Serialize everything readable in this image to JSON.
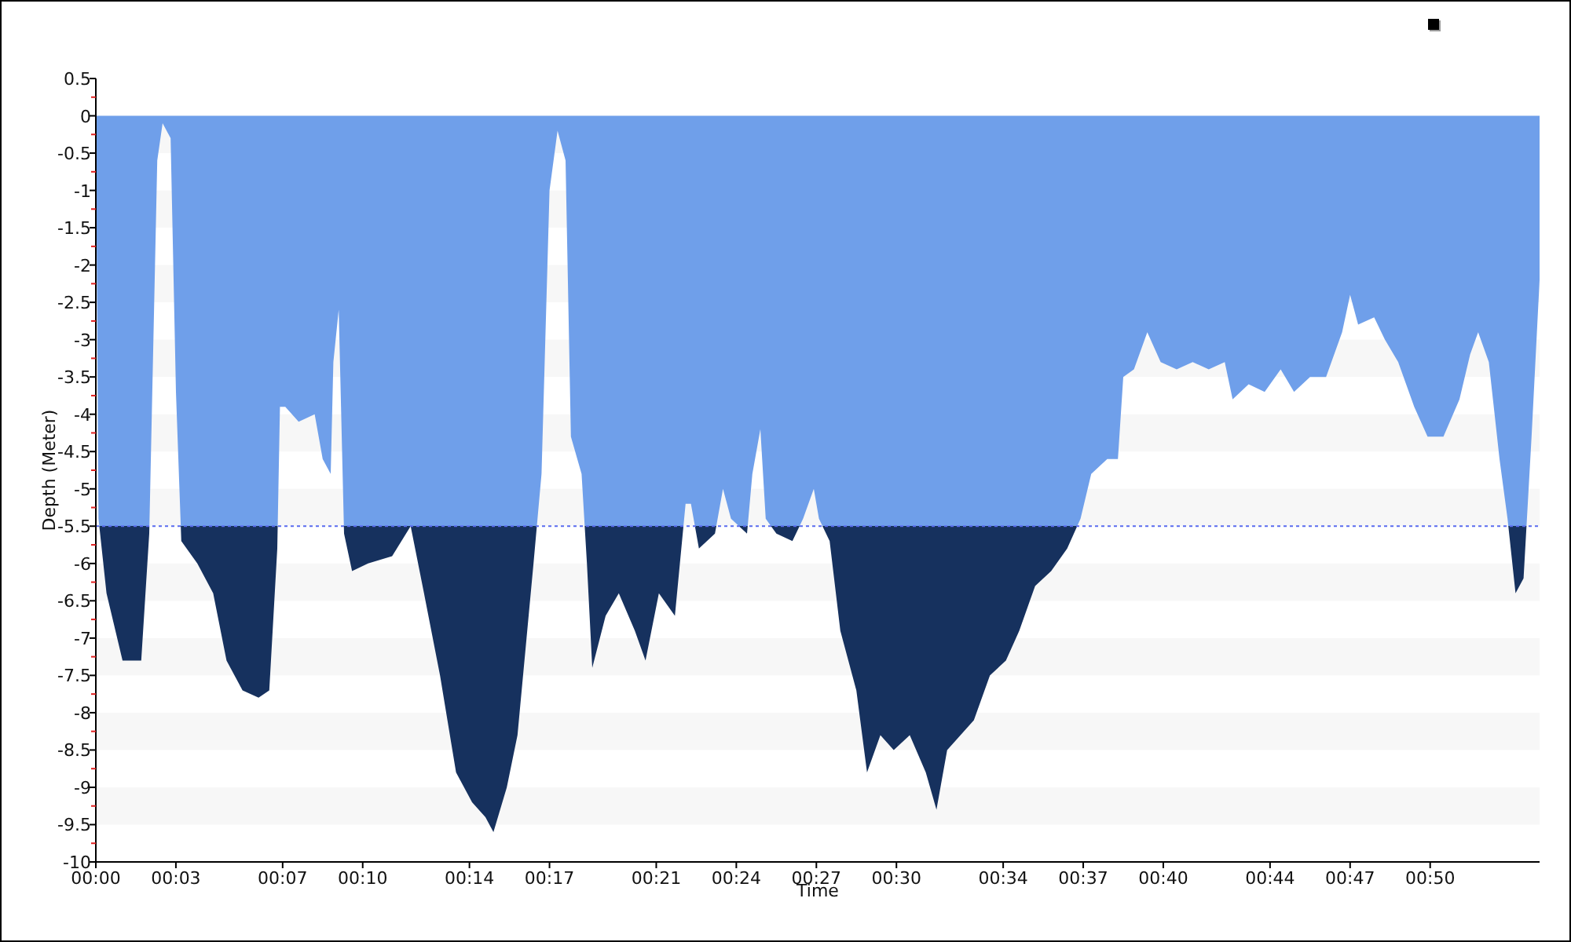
{
  "chart_panel": {
    "chart_data": {
      "type": "area",
      "xlabel": "Time",
      "ylabel": "Depth (Meter)",
      "x": [
        0,
        0.1,
        0.4,
        1.0,
        1.7,
        2.0,
        2.3,
        2.5,
        2.8,
        3.0,
        3.2,
        3.8,
        4.4,
        4.9,
        5.5,
        6.1,
        6.5,
        6.8,
        6.9,
        7.1,
        7.6,
        8.2,
        8.5,
        8.8,
        8.9,
        9.1,
        9.3,
        9.6,
        10.2,
        11.1,
        11.8,
        12.3,
        12.9,
        13.5,
        14.1,
        14.6,
        14.9,
        15.4,
        15.8,
        16.4,
        16.7,
        17.0,
        17.3,
        17.6,
        17.8,
        18.2,
        18.4,
        18.6,
        19.1,
        19.6,
        20.2,
        20.6,
        21.1,
        21.7,
        22.1,
        22.3,
        22.6,
        23.2,
        23.5,
        23.8,
        24.4,
        24.6,
        24.9,
        25.1,
        25.5,
        26.1,
        26.5,
        26.9,
        27.1,
        27.5,
        27.9,
        28.5,
        28.9,
        29.4,
        29.9,
        30.5,
        31.1,
        31.5,
        31.9,
        32.4,
        32.9,
        33.5,
        34.1,
        34.6,
        35.2,
        35.8,
        36.4,
        36.9,
        37.3,
        37.9,
        38.3,
        38.5,
        38.9,
        39.4,
        39.9,
        40.5,
        41.1,
        41.7,
        42.3,
        42.6,
        43.2,
        43.8,
        44.4,
        44.9,
        45.5,
        46.1,
        46.7,
        47.0,
        47.3,
        47.9,
        48.3,
        48.8,
        49.4,
        49.9,
        50.5,
        51.1,
        51.5,
        51.8,
        52.2,
        52.6,
        52.9,
        53.2,
        53.5,
        53.8,
        54.1
      ],
      "series": [
        {
          "color": "#6f9fea",
          "values": [
            0,
            -5.4,
            -6.4,
            -7.3,
            -7.3,
            -5.6,
            -0.6,
            -0.1,
            -0.3,
            -3.7,
            -5.7,
            -6.0,
            -6.4,
            -7.3,
            -7.7,
            -7.8,
            -7.7,
            -5.8,
            -3.9,
            -3.9,
            -4.1,
            -4.0,
            -4.6,
            -4.8,
            -3.3,
            -2.6,
            -5.6,
            -6.1,
            -6.0,
            -5.9,
            -5.5,
            -6.4,
            -7.5,
            -8.8,
            -9.2,
            -9.4,
            -9.6,
            -9.0,
            -8.3,
            -6.0,
            -4.8,
            -1.0,
            -0.2,
            -0.6,
            -4.3,
            -4.8,
            -6.0,
            -7.4,
            -6.7,
            -6.4,
            -6.9,
            -7.3,
            -6.4,
            -6.7,
            -5.2,
            -5.2,
            -5.8,
            -5.6,
            -5.0,
            -5.4,
            -5.6,
            -4.8,
            -4.2,
            -5.4,
            -5.6,
            -5.7,
            -5.4,
            -5.0,
            -5.4,
            -5.7,
            -6.9,
            -7.7,
            -8.8,
            -8.3,
            -8.5,
            -8.3,
            -8.8,
            -9.3,
            -8.5,
            -8.3,
            -8.1,
            -7.5,
            -7.3,
            -6.9,
            -6.3,
            -6.1,
            -5.8,
            -5.4,
            -4.8,
            -4.6,
            -4.6,
            -3.5,
            -3.4,
            -2.9,
            -3.3,
            -3.4,
            -3.3,
            -3.4,
            -3.3,
            -3.8,
            -3.6,
            -3.7,
            -3.4,
            -3.7,
            -3.5,
            -3.5,
            -2.9,
            -2.4,
            -2.8,
            -2.7,
            -3.0,
            -3.3,
            -3.9,
            -4.3,
            -4.3,
            -3.8,
            -3.2,
            -2.9,
            -3.3,
            -4.6,
            -5.4,
            -6.4,
            -6.2,
            -4.3,
            -2.2
          ]
        }
      ],
      "xlim": [
        0,
        54.1
      ],
      "ylim": [
        -10,
        0.5
      ],
      "xticks": [
        {
          "value": 0,
          "label": "00:00"
        },
        {
          "value": 3,
          "label": "00:03"
        },
        {
          "value": 7,
          "label": "00:07"
        },
        {
          "value": 10,
          "label": "00:10"
        },
        {
          "value": 14,
          "label": "00:14"
        },
        {
          "value": 17,
          "label": "00:17"
        },
        {
          "value": 21,
          "label": "00:21"
        },
        {
          "value": 24,
          "label": "00:24"
        },
        {
          "value": 27,
          "label": "00:27"
        },
        {
          "value": 30,
          "label": "00:30"
        },
        {
          "value": 34,
          "label": "00:34"
        },
        {
          "value": 37,
          "label": "00:37"
        },
        {
          "value": 40,
          "label": "00:40"
        },
        {
          "value": 44,
          "label": "00:44"
        },
        {
          "value": 47,
          "label": "00:47"
        },
        {
          "value": 50,
          "label": "00:50"
        }
      ],
      "yticks": [
        0.5,
        0,
        -0.5,
        -1,
        -1.5,
        -2,
        -2.5,
        -3,
        -3.5,
        -4,
        -4.5,
        -5,
        -5.5,
        -6,
        -6.5,
        -7,
        -7.5,
        -8,
        -8.5,
        -9,
        -9.5,
        -10
      ],
      "ref_lines": [
        {
          "axis": "y",
          "value": -5.5
        }
      ]
    }
  }
}
